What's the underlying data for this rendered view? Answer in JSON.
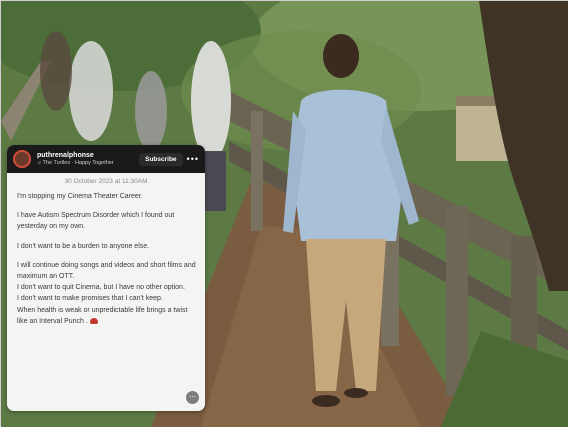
{
  "story": {
    "username": "puthrenalphonse",
    "song": "♫ The Turtles · Happy Together",
    "subscribe_label": "Subscribe",
    "more_label": "•••",
    "timestamp": "30 October 2023 at 11:30AM",
    "paragraphs": [
      "I'm stopping my Cinema Theater Career.",
      "I have Autism Spectrum Disorder which I found out yesterday on my own.",
      "I don't want to be a burden to anyone else.",
      "I will continue doing songs and videos and short films and maximum an OTT.",
      "I don't want to quit Cinema, but I have no other option.",
      "I don't want to make promises that I can't keep.",
      "When health is weak or unpredictable life brings a twist like an Interval Punch ."
    ],
    "badge": "⋯"
  },
  "colors": {
    "story_bg": "#f4f4f2",
    "header_bg": "#1a1a1a",
    "avatar_ring": "#d24c3b"
  }
}
